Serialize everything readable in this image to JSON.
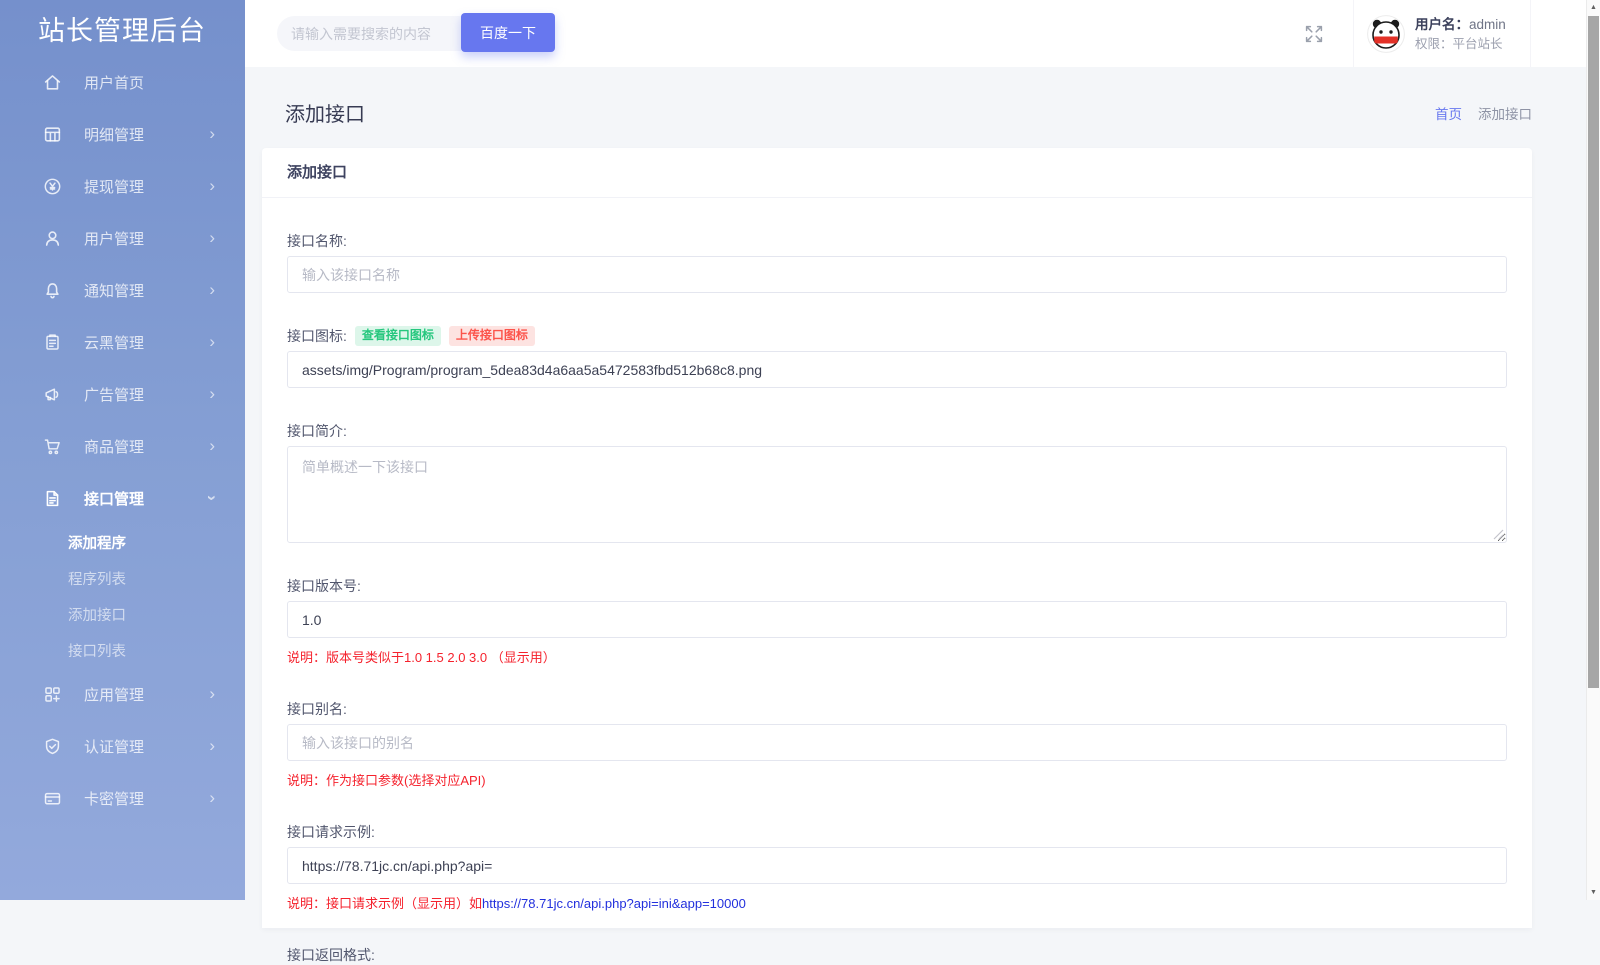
{
  "colors": {
    "primary": "#6777ef",
    "sidebar_gradient_top": "#7590cc",
    "sidebar_gradient_bottom": "#93a9dc",
    "hint_red": "#f5222d",
    "hint_link_blue": "#2230dd",
    "badge_green_text": "#26c77e",
    "badge_green_bg": "#ddf6ea",
    "badge_red_text": "#fc544b",
    "badge_red_bg": "#fde3e1",
    "breadcrumb_link": "#6777ef",
    "avatar_band_red": "#e33127"
  },
  "sidebar": {
    "title": "站长管理后台",
    "items": [
      {
        "label": "用户首页",
        "icon": "home-icon"
      },
      {
        "label": "明细管理",
        "icon": "table-icon"
      },
      {
        "label": "提现管理",
        "icon": "yen-circle-icon"
      },
      {
        "label": "用户管理",
        "icon": "user-icon"
      },
      {
        "label": "通知管理",
        "icon": "bell-icon"
      },
      {
        "label": "云黑管理",
        "icon": "clipboard-icon"
      },
      {
        "label": "广告管理",
        "icon": "megaphone-icon"
      },
      {
        "label": "商品管理",
        "icon": "cart-icon"
      },
      {
        "label": "接口管理",
        "icon": "file-text-icon",
        "expanded": true
      },
      {
        "label": "应用管理",
        "icon": "app-grid-icon"
      },
      {
        "label": "认证管理",
        "icon": "shield-check-icon"
      },
      {
        "label": "卡密管理",
        "icon": "credit-card-icon"
      }
    ],
    "api_submenu": [
      {
        "label": "添加程序",
        "active": true
      },
      {
        "label": "程序列表"
      },
      {
        "label": "添加接口"
      },
      {
        "label": "接口列表"
      }
    ]
  },
  "topbar": {
    "search_placeholder": "请输入需要搜索的内容",
    "search_button": "百度一下",
    "user": {
      "name_label": "用户名：",
      "name_value": "admin",
      "role_line": "权限：平台站长"
    }
  },
  "page": {
    "title": "添加接口",
    "breadcrumb_home": "首页",
    "breadcrumb_current": "添加接口"
  },
  "form": {
    "section_title": "添加接口",
    "name": {
      "label": "接口名称:",
      "placeholder": "输入该接口名称"
    },
    "icon": {
      "label": "接口图标:",
      "badge_view": "查看接口图标",
      "badge_upload": "上传接口图标",
      "value": "assets/img/Program/program_5dea83d4a6aa5a5472583fbd512b68c8.png"
    },
    "intro": {
      "label": "接口简介:",
      "placeholder": "简单概述一下该接口"
    },
    "version": {
      "label": "接口版本号:",
      "value": "1.0",
      "hint": "说明：版本号类似于1.0 1.5 2.0 3.0 （显示用）"
    },
    "alias": {
      "label": "接口别名:",
      "placeholder": "输入该接口的别名",
      "hint": "说明：作为接口参数(选择对应API)"
    },
    "request": {
      "label": "接口请求示例:",
      "value": "https://78.71jc.cn/api.php?api=",
      "hint_text": "说明：接口请求示例（显示用）如",
      "hint_link": "https://78.71jc.cn/api.php?api=ini&app=10000"
    },
    "return_format": {
      "label": "接口返回格式:"
    }
  }
}
